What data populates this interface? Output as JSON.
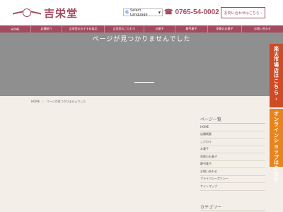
{
  "header": {
    "logo_text": "吉栄堂",
    "translate_label": "Select Language",
    "phone": "0765-54-0002",
    "contact_button": "お問い合わせはこちら ›"
  },
  "nav": {
    "items": [
      {
        "label": "HOME"
      },
      {
        "label": "店舗紹介"
      },
      {
        "label": "吉栄堂のおすすめ商品"
      },
      {
        "label": "吉栄堂のこだわり"
      },
      {
        "label": "お菓子"
      },
      {
        "label": "慶弔菓子"
      },
      {
        "label": "季節のお菓子"
      },
      {
        "label": "お問い合わせ"
      }
    ]
  },
  "hero": {
    "title": "ページが見つかりませんでした"
  },
  "breadcrumb": {
    "home": "HOME",
    "separator": "›",
    "current": "ページが見つかりませんでした"
  },
  "side_banners": {
    "banner1": [
      "楽",
      "天",
      "市",
      "場",
      "店",
      "は",
      "こ",
      "ち",
      "ら"
    ],
    "banner2": [
      "オ",
      "ン",
      "ラ",
      "イ",
      "ン",
      "シ",
      "ョ",
      "ッ",
      "プ",
      "は",
      "こ",
      "ち",
      "ら"
    ],
    "arrow": "›"
  },
  "sidebar": {
    "title": "ページ一覧",
    "items": [
      "HOME",
      "店舗概要",
      "こだわり",
      "お菓子",
      "季節のお菓子",
      "慶弔菓子",
      "お問い合わせ",
      "プライバシーポリシー",
      "サイトマップ"
    ],
    "category_title": "カテゴリー"
  },
  "colors": {
    "brand": "#a34a5f",
    "hero_bg": "#8f8f8f",
    "page_bg": "#f3efe8",
    "banner_rakuten": "#d04a24",
    "banner_shop": "#e8841d"
  }
}
